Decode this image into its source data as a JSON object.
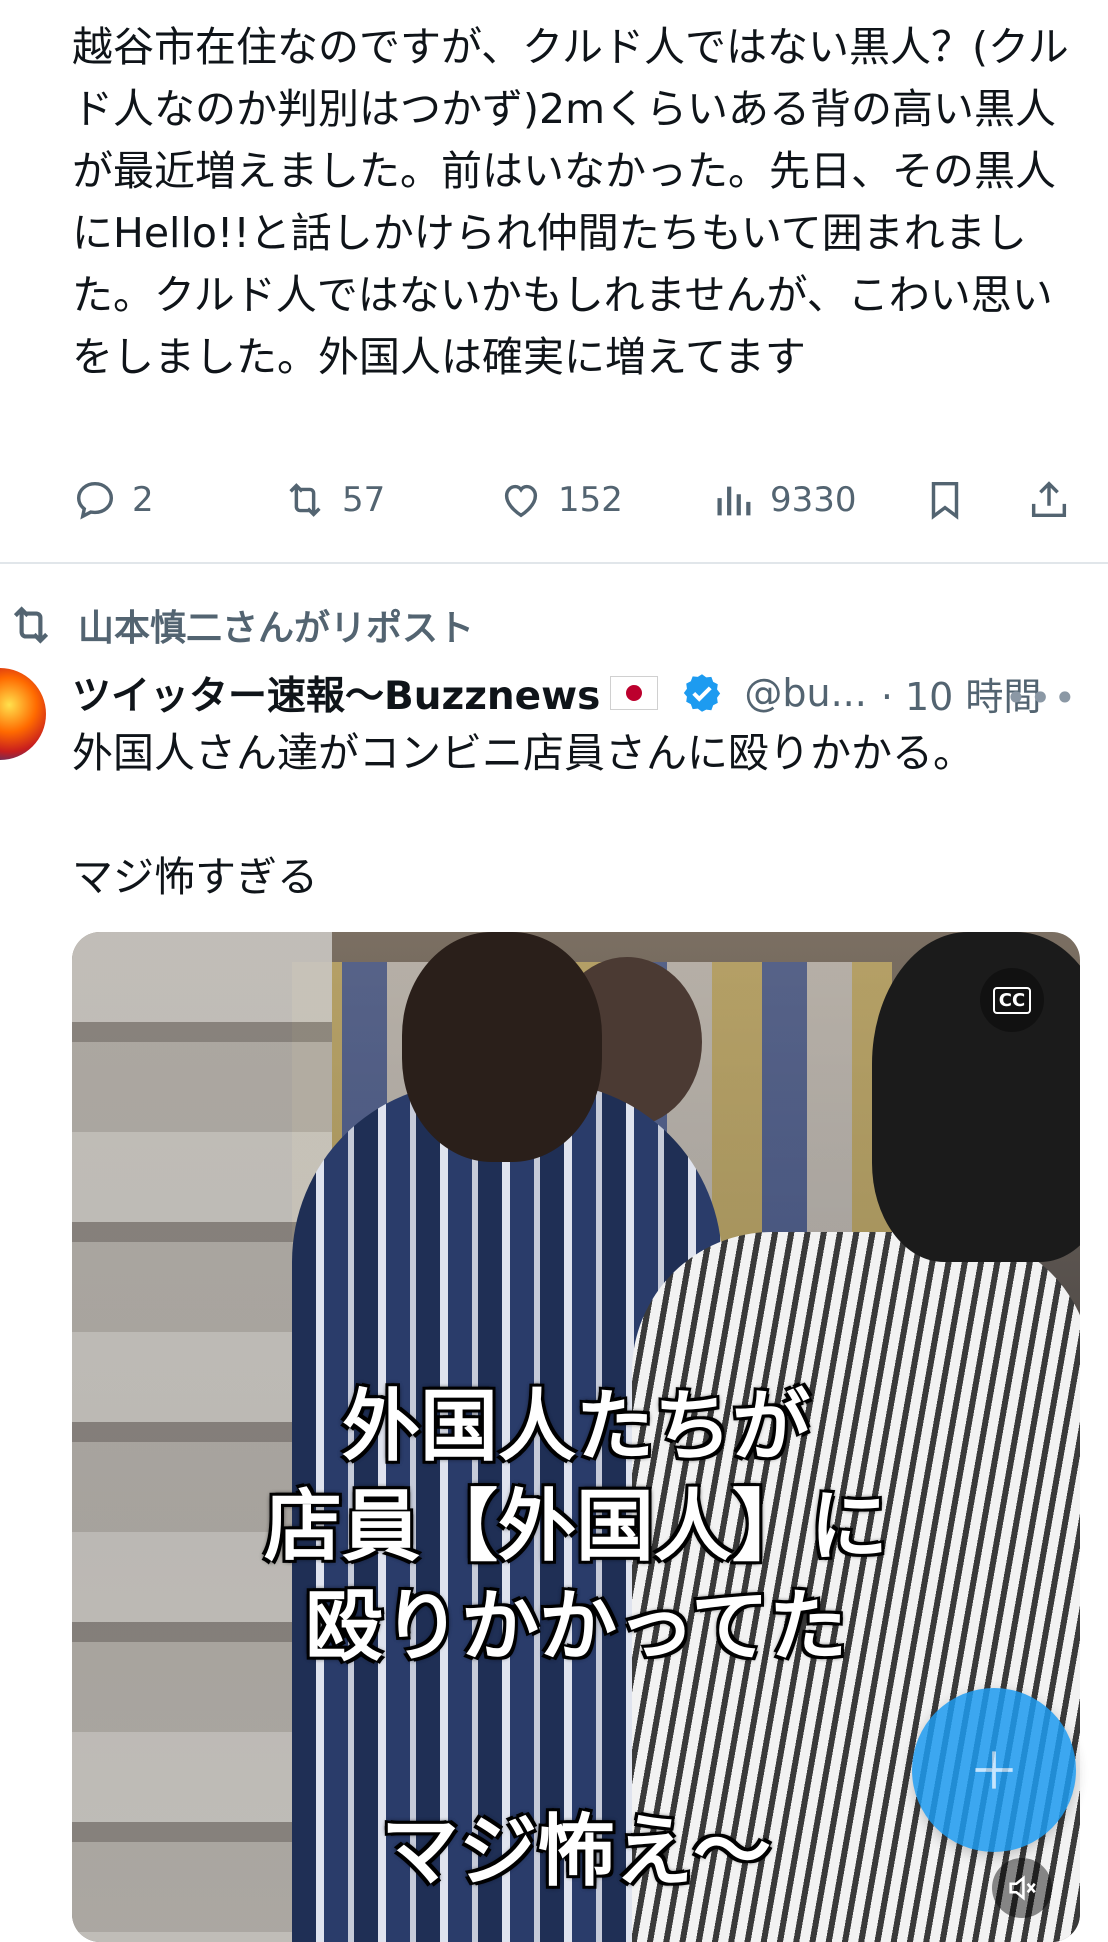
{
  "prev_tweet": {
    "text": "越谷市在住なのですが、クルド人ではない黒人？(クルド人なのか判別はつかず)2mくらいある背の高い黒人が最近増えました。前はいなかった。先日、その黒人にHello!!と話しかけられ仲間たちもいて囲まれました。クルド人ではないかもしれませんが、こわい思いをしました。外国人は確実に増えてます",
    "actions": {
      "replies": "2",
      "reposts": "57",
      "likes": "152",
      "views": "9330"
    }
  },
  "repost_context": "山本慎二さんがリポスト",
  "tweet": {
    "author_name": "ツイッター速報〜Buzznews",
    "handle": "@bu...",
    "time": "· 10 時間",
    "more": "•••",
    "text": "外国人さん達がコンビニ店員さんに殴りかかる。\n\nマジ怖すぎる",
    "media": {
      "cc_label": "CC",
      "caption_lines": [
        "外国人たちが",
        "店員【外国人】に",
        "殴りかかってた",
        "マジ怖え〜"
      ]
    }
  },
  "fab_icon": "compose-plus-icon",
  "colors": {
    "text": "#0f1419",
    "muted": "#536471",
    "accent": "#1d9bf0",
    "divider": "#e1e6ea"
  }
}
